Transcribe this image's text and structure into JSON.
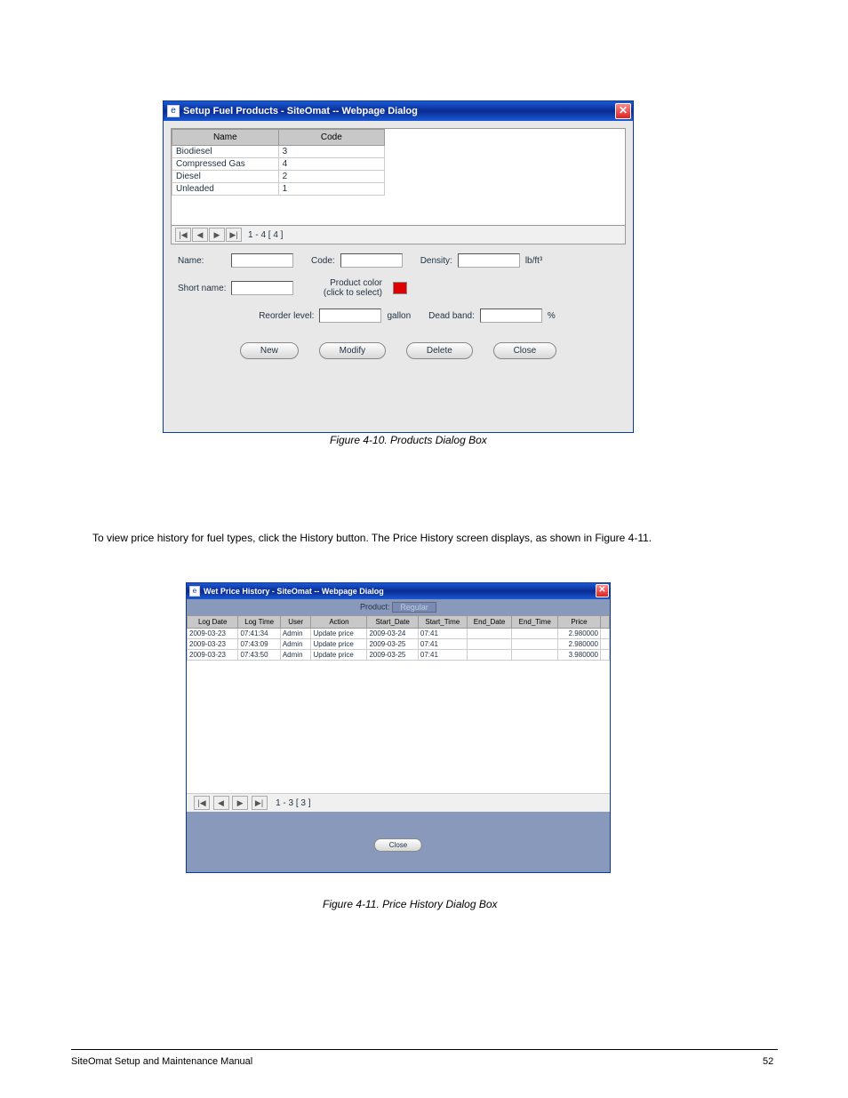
{
  "page_text": {
    "fig1_caption": "Figure 4-10. Products Dialog Box",
    "view_history_intro": "To view price history for fuel types, click the History button. The Price History screen displays, as shown in Figure 4-11.",
    "fig2_caption": "Figure 4-11. Price History Dialog Box"
  },
  "footer": {
    "manual": "SiteOmat Setup and Maintenance Manual",
    "page": "52"
  },
  "dialog1": {
    "title": "Setup Fuel Products - SiteOmat -- Webpage Dialog",
    "columns": [
      "Name",
      "Code"
    ],
    "rows": [
      {
        "name": "Biodiesel",
        "code": "3"
      },
      {
        "name": "Compressed Gas",
        "code": "4"
      },
      {
        "name": "Diesel",
        "code": "2"
      },
      {
        "name": "Unleaded",
        "code": "1"
      }
    ],
    "nav_label": "1 - 4  [ 4 ]",
    "form": {
      "name_label": "Name:",
      "code_label": "Code:",
      "density_label": "Density:",
      "density_unit": "lb/ft³",
      "shortname_label": "Short name:",
      "color_label_line1": "Product color",
      "color_label_line2": "(click to select)",
      "reorder_label": "Reorder level:",
      "reorder_unit": "gallon",
      "deadband_label": "Dead band:",
      "deadband_unit": "%"
    },
    "buttons": {
      "new": "New",
      "modify": "Modify",
      "delete": "Delete",
      "close": "Close"
    }
  },
  "dialog2": {
    "title": "Wet Price History - SiteOmat -- Webpage Dialog",
    "product_label": "Product:",
    "product_value": "Regular",
    "columns": [
      "Log Date",
      "Log Time",
      "User",
      "Action",
      "Start_Date",
      "Start_Time",
      "End_Date",
      "End_Time",
      "Price"
    ],
    "rows": [
      {
        "log_date": "2009-03-23",
        "log_time": "07:41:34",
        "user": "Admin",
        "action": "Update price",
        "start_date": "2009-03-24",
        "start_time": "07:41",
        "end_date": "",
        "end_time": "",
        "price": "2.980000"
      },
      {
        "log_date": "2009-03-23",
        "log_time": "07:43:09",
        "user": "Admin",
        "action": "Update price",
        "start_date": "2009-03-25",
        "start_time": "07:41",
        "end_date": "",
        "end_time": "",
        "price": "2.980000"
      },
      {
        "log_date": "2009-03-23",
        "log_time": "07:43:50",
        "user": "Admin",
        "action": "Update price",
        "start_date": "2009-03-25",
        "start_time": "07:41",
        "end_date": "",
        "end_time": "",
        "price": "3.980000"
      }
    ],
    "nav_label": "1 - 3  [ 3 ]",
    "close_button": "Close"
  }
}
